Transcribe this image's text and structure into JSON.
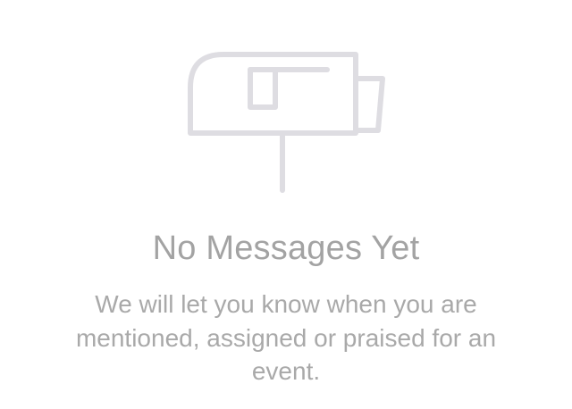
{
  "empty_state": {
    "icon": "mailbox-icon",
    "icon_color": "#dedde2",
    "title": "No Messages Yet",
    "message": "We will let you know when you are mentioned, assigned or praised for an event.",
    "title_color": "#a3a3a3",
    "message_color": "#a9a9a9"
  }
}
